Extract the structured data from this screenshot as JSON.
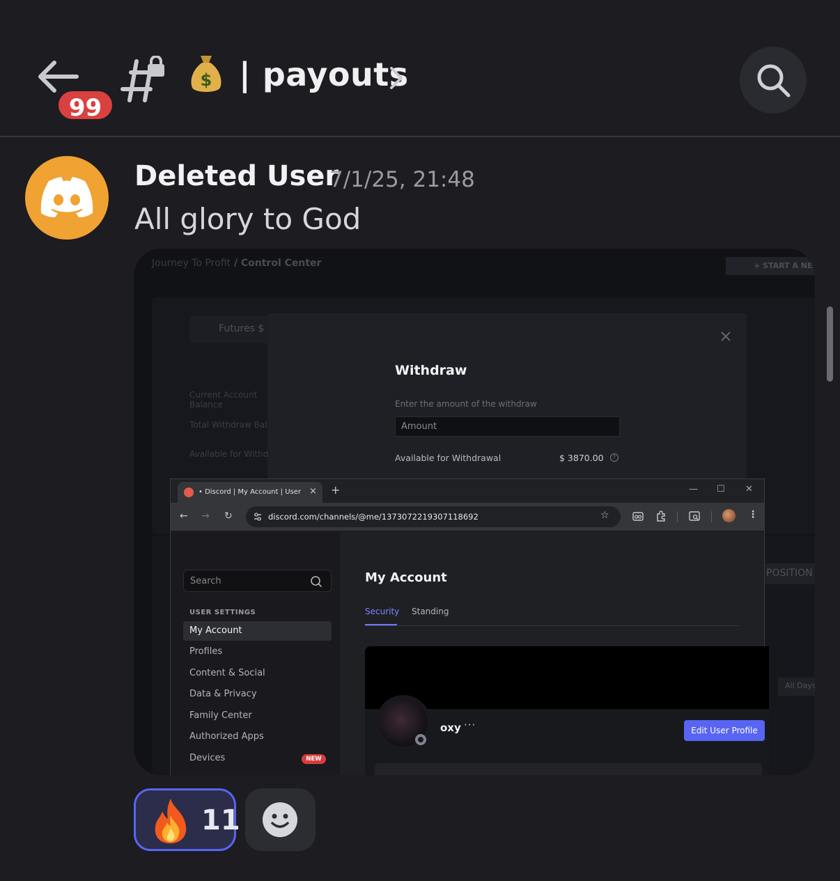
{
  "header": {
    "unread_badge": "99",
    "channel_name": "| payouts",
    "channel_icon": "hash-lock-icon",
    "channel_emoji": "money-bag-icon"
  },
  "message": {
    "author": "Deleted User",
    "timestamp": "7/1/25, 21:48",
    "text": "All glory to God"
  },
  "screenshot": {
    "background": {
      "breadcrumb_prefix": "Journey To Profit",
      "breadcrumb_current": " / Control Center",
      "start_button": "+ START A NEW",
      "futures_label": "Futures $",
      "current_balance": "Current Account Balance",
      "total_withdraw": "Total Withdraw Bal",
      "available": "Available for Withdr",
      "position_button": "POSITION",
      "all_days": "All Days"
    },
    "withdraw_modal": {
      "title": "Withdraw",
      "field_label": "Enter the amount of the withdraw",
      "amount_placeholder": "Amount",
      "available_label": "Available for Withdrawal",
      "available_amount": "$ 3870.00",
      "help": "?"
    },
    "browser": {
      "tab_title": "• Discord | My Account | User Se",
      "tab_close": "×",
      "new_tab": "+",
      "url": "discord.com/channels/@me/1373072219307118692",
      "window_controls": [
        "—",
        "☐",
        "✕"
      ]
    },
    "settings": {
      "search_placeholder": "Search",
      "section_header": "USER SETTINGS",
      "items": [
        {
          "label": "My Account"
        },
        {
          "label": "Profiles"
        },
        {
          "label": "Content & Social"
        },
        {
          "label": "Data & Privacy"
        },
        {
          "label": "Family Center"
        },
        {
          "label": "Authorized Apps"
        },
        {
          "label": "Devices",
          "badge": "NEW"
        }
      ],
      "page_title": "My Account",
      "tabs": [
        "Security",
        "Standing"
      ],
      "profile_name": "oxy",
      "more": "···",
      "edit_button": "Edit User Profile"
    }
  },
  "reactions": [
    {
      "emoji": "fire-icon",
      "count": "11",
      "selected": true
    }
  ],
  "add_reaction_icon": "smiley-icon",
  "colors": {
    "background": "#1c1c21",
    "accent": "#5865f2",
    "badge_red": "#d8413f",
    "avatar_orange": "#f0a232"
  }
}
